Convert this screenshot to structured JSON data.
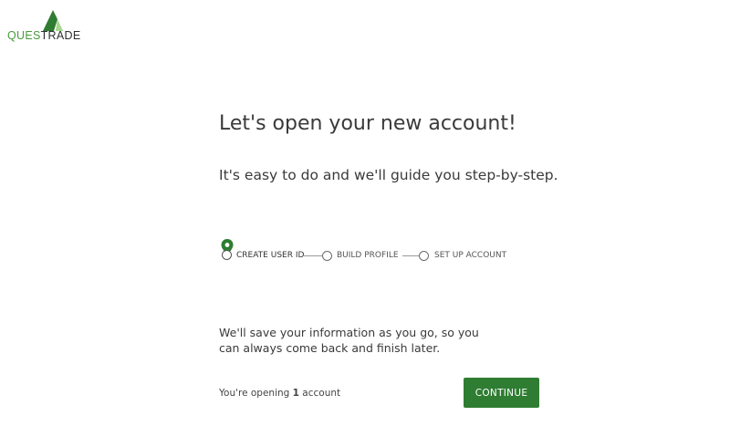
{
  "brand": {
    "name_part1": "QUES",
    "name_part2": "TRADE",
    "green": "#4c9a3f",
    "dark": "#2f2f2f"
  },
  "main": {
    "title": "Let's open your new account!",
    "subtitle": "It's easy to do and we'll guide you step-by-step."
  },
  "steps": [
    {
      "label": "CREATE USER ID",
      "state": "current",
      "icon": "location-pin-icon"
    },
    {
      "label": "BUILD PROFILE",
      "state": "pending"
    },
    {
      "label": "SET UP ACCOUNT",
      "state": "pending"
    }
  ],
  "info": {
    "line1": "We'll save your information as you go, so you",
    "line2": "can always come back and finish later."
  },
  "account": {
    "prefix": "You're opening ",
    "count": "1",
    "suffix": " account"
  },
  "actions": {
    "continue_label": "CONTINUE",
    "button_color": "#2e7d32"
  }
}
